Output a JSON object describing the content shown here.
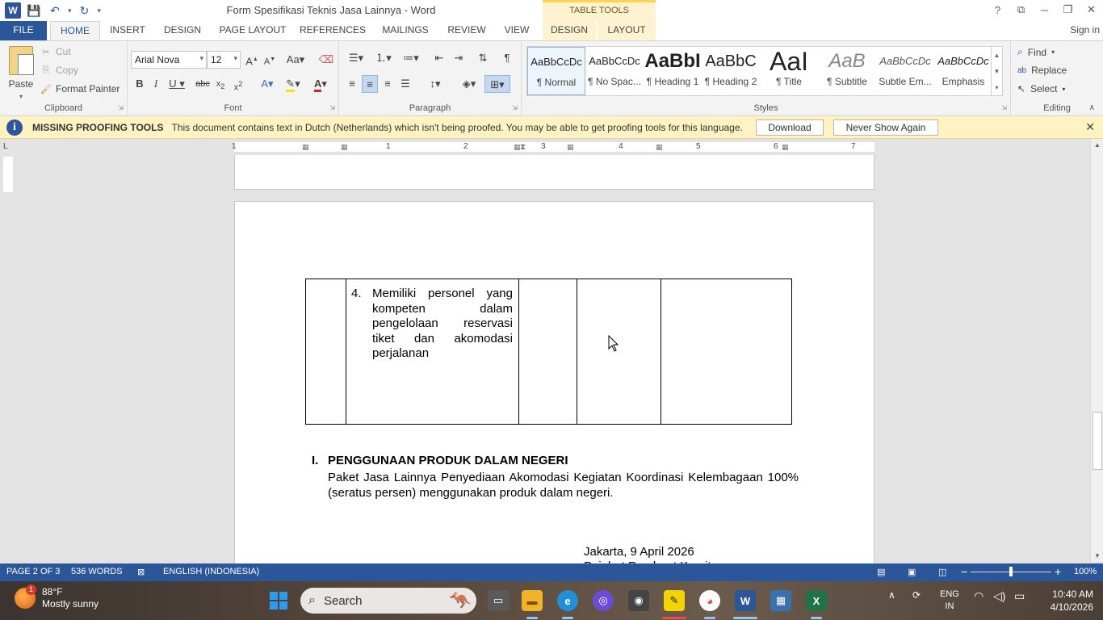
{
  "window": {
    "title": "Form Spesifikasi Teknis Jasa Lainnya - Word",
    "context_tab_group": "TABLE TOOLS",
    "help": "?",
    "controls": {
      "restore_ribbon": "⧉",
      "minimize": "─",
      "maximize": "❐",
      "close": "✕"
    }
  },
  "qat": {
    "logo": "W",
    "save": "💾",
    "undo": "↶",
    "redo": "↻",
    "more": "▾"
  },
  "tabs": {
    "file": "FILE",
    "home": "HOME",
    "insert": "INSERT",
    "design": "DESIGN",
    "page_layout": "PAGE LAYOUT",
    "references": "REFERENCES",
    "mailings": "MAILINGS",
    "review": "REVIEW",
    "view": "VIEW",
    "table_design": "DESIGN",
    "table_layout": "LAYOUT",
    "sign_in": "Sign in"
  },
  "clipboard": {
    "paste": "Paste",
    "cut": "Cut",
    "copy": "Copy",
    "format_painter": "Format Painter",
    "label": "Clipboard"
  },
  "font": {
    "name": "Arial Nova",
    "size": "12",
    "label": "Font"
  },
  "paragraph": {
    "label": "Paragraph"
  },
  "styles": {
    "label": "Styles",
    "items": [
      {
        "preview": "AaBbCcDc",
        "name": "¶ Normal"
      },
      {
        "preview": "AaBbCcDc",
        "name": "¶ No Spac..."
      },
      {
        "preview": "AaBbI",
        "name": "¶ Heading 1"
      },
      {
        "preview": "AaBbC",
        "name": "¶ Heading 2"
      },
      {
        "preview": "AaI",
        "name": "¶ Title"
      },
      {
        "preview": "AaB",
        "name": "¶ Subtitle"
      },
      {
        "preview": "AaBbCcDc",
        "name": "Subtle Em..."
      },
      {
        "preview": "AaBbCcDc",
        "name": "Emphasis"
      }
    ]
  },
  "editing": {
    "find": "Find",
    "replace": "Replace",
    "select": "Select",
    "label": "Editing"
  },
  "message_bar": {
    "title": "MISSING PROOFING TOOLS",
    "text": "This document contains text in Dutch (Netherlands) which isn't being proofed. You may be able to get proofing tools for this language.",
    "download": "Download",
    "never_show": "Never Show Again",
    "close": "✕"
  },
  "ruler": {
    "numbers": [
      "1",
      "1",
      "2",
      "3",
      "4",
      "5",
      "6",
      "7"
    ],
    "corner": "L"
  },
  "document": {
    "table_row": {
      "number": "4.",
      "text": "Memiliki personel yang kompeten dalam pengelolaan reservasi tiket dan akomodasi perjalanan"
    },
    "section": {
      "number": "I.",
      "heading": "PENGGUNAAN PRODUK DALAM NEGERI",
      "body": "Paket Jasa Lainnya Penyediaan Akomodasi Kegiatan Koordinasi Kelembagaan 100% (seratus persen) menggunakan produk dalam negeri."
    },
    "signature": {
      "date": "Jakarta, 9 April 2026",
      "role": "Pejabat Pembuat Komitmen"
    }
  },
  "status": {
    "page": "PAGE 2 OF 3",
    "words": "536 WORDS",
    "language": "ENGLISH (INDONESIA)",
    "zoom": "100%",
    "zoom_minus": "−",
    "zoom_plus": "+"
  },
  "taskbar": {
    "weather_temp": "88°F",
    "weather_desc": "Mostly sunny",
    "weather_badge": "1",
    "search": "Search",
    "lang_top": "ENG",
    "lang_bottom": "IN",
    "time": "10:40 AM",
    "date": "4/10/2026"
  }
}
